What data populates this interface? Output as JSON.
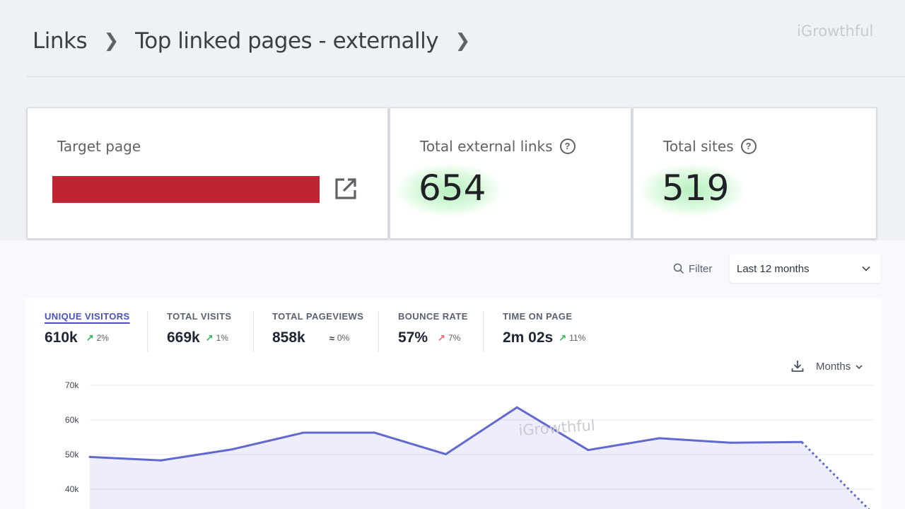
{
  "breadcrumb": {
    "item1": "Links",
    "item2": "Top linked pages - externally"
  },
  "watermark": "iGrowthful",
  "cards": {
    "target": {
      "label": "Target page"
    },
    "links": {
      "label": "Total external links",
      "value": "654"
    },
    "sites": {
      "label": "Total sites",
      "value": "519"
    }
  },
  "toolbar": {
    "filter_label": "Filter",
    "period": "Last 12 months"
  },
  "stats": [
    {
      "label": "UNIQUE VISITORS",
      "value": "610k",
      "change": "2%",
      "trend": "up"
    },
    {
      "label": "TOTAL VISITS",
      "value": "669k",
      "change": "1%",
      "trend": "up"
    },
    {
      "label": "TOTAL PAGEVIEWS",
      "value": "858k",
      "change": "0%",
      "trend": "flat"
    },
    {
      "label": "BOUNCE RATE",
      "value": "57%",
      "change": "7%",
      "trend": "up-red"
    },
    {
      "label": "TIME ON PAGE",
      "value": "2m 02s",
      "change": "11%",
      "trend": "up"
    }
  ],
  "chart_controls": {
    "granularity": "Months"
  },
  "colors": {
    "accent": "#5a63cc",
    "highlight": "#bf2430"
  },
  "chart_data": {
    "type": "area",
    "series": [
      {
        "values": [
          49300,
          48300,
          51500,
          56300,
          56300,
          50100,
          63600,
          51300,
          54700,
          53400,
          53600,
          33000
        ]
      }
    ],
    "dashed_from_index": 10,
    "y_ticks": [
      "70k",
      "60k",
      "50k",
      "40k"
    ],
    "ylim": [
      30000,
      70000
    ],
    "grid": true
  }
}
